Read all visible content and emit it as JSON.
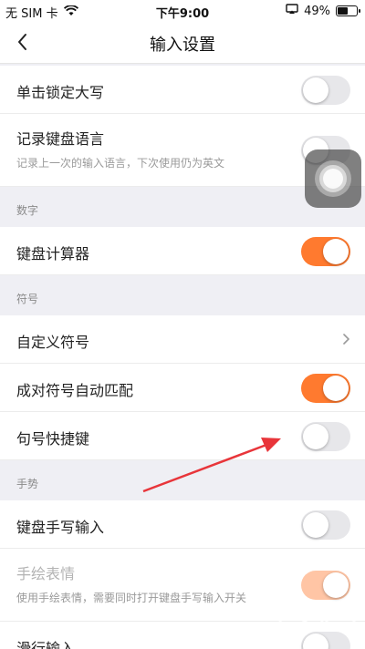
{
  "status_bar": {
    "carrier": "无 SIM 卡",
    "time": "下午9:00",
    "battery": "49%",
    "battery_level": 0.49
  },
  "nav": {
    "title": "输入设置",
    "back_icon": "chevron-left-icon"
  },
  "rows": {
    "caps_lock": {
      "label": "单击锁定大写",
      "toggle": "off"
    },
    "keyboard_language": {
      "label": "记录键盘语言",
      "sub": "记录上一次的输入语言，下次使用仍为英文",
      "toggle": "off"
    },
    "keyboard_calculator": {
      "label": "键盘计算器",
      "toggle": "on"
    },
    "custom_symbols": {
      "label": "自定义符号"
    },
    "pair_symbols": {
      "label": "成对符号自动匹配",
      "toggle": "on"
    },
    "period_shortcut": {
      "label": "句号快捷键",
      "toggle": "off"
    },
    "handwriting": {
      "label": "键盘手写输入",
      "toggle": "off"
    },
    "hand_drawn_emoji": {
      "label": "手绘表情",
      "sub": "使用手绘表情，需要同时打开键盘手写输入开关",
      "toggle": "on",
      "disabled": true
    },
    "swipe_input": {
      "label": "滑行输入"
    }
  },
  "sections": {
    "numbers": "数字",
    "symbols": "符号",
    "gestures": "手势"
  },
  "colors": {
    "accent": "#ff7a2f",
    "toggle_off": "#e7e7ea",
    "arrow": "#e8353a"
  }
}
